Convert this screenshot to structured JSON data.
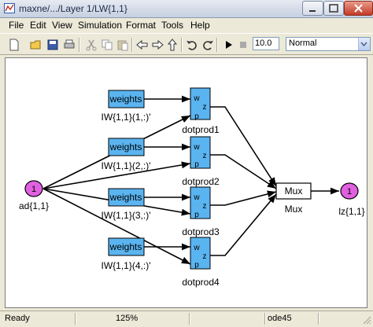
{
  "window": {
    "title": "maxne/.../Layer 1/LW{1,1}"
  },
  "menu": [
    "File",
    "Edit",
    "View",
    "Simulation",
    "Format",
    "Tools",
    "Help"
  ],
  "toolbar": {
    "stop_time": "10.0",
    "sim_mode": "Normal",
    "icons": [
      "new-model-icon",
      "open-icon",
      "save-icon",
      "print-icon",
      "cut-icon",
      "copy-icon",
      "paste-icon",
      "back-icon",
      "forward-icon",
      "up-icon",
      "undo-icon",
      "redo-icon",
      "start-simulation-icon",
      "stop-simulation-icon"
    ]
  },
  "diagram": {
    "input": {
      "number": "1",
      "label": "ad{1,1}"
    },
    "weights": [
      {
        "block": "weights",
        "label": "IW{1,1}(1,:)'"
      },
      {
        "block": "weights",
        "label": "IW{1,1}(2,:)'"
      },
      {
        "block": "weights",
        "label": "IW{1,1}(3,:)'"
      },
      {
        "block": "weights",
        "label": "IW{1,1}(4,:)'"
      }
    ],
    "dotprods": [
      {
        "label": "dotprod1",
        "ports": [
          "w",
          "p"
        ],
        "out": "z"
      },
      {
        "label": "dotprod2",
        "ports": [
          "w",
          "p"
        ],
        "out": "z"
      },
      {
        "label": "dotprod3",
        "ports": [
          "w",
          "p"
        ],
        "out": "z"
      },
      {
        "label": "dotprod4",
        "ports": [
          "w",
          "p"
        ],
        "out": "z"
      }
    ],
    "mux": {
      "text": "Mux",
      "label": "Mux"
    },
    "output": {
      "number": "1",
      "label": "lz{1,1}"
    },
    "colors": {
      "blue_block": "#5ab4f0",
      "port": "#e060e0"
    }
  },
  "status": {
    "left": "Ready",
    "zoom": "125%",
    "solver": "ode45"
  }
}
